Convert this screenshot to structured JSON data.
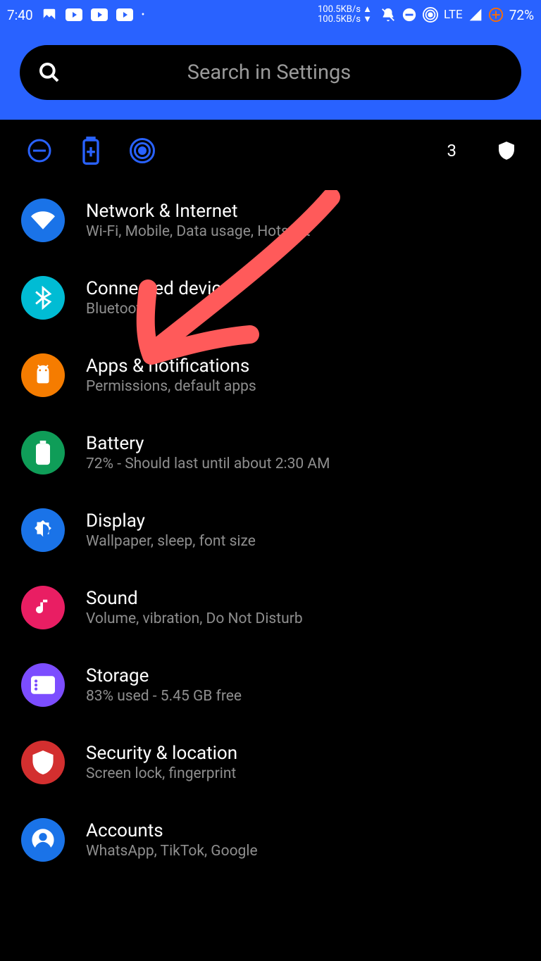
{
  "status": {
    "time": "7:40",
    "net_up": "100.5KB/s ▲",
    "net_dn": "100.5KB/s ▼",
    "lte": "LTE",
    "battery": "72%"
  },
  "search": {
    "placeholder": "Search in Settings"
  },
  "quick": {
    "count": "3"
  },
  "items": [
    {
      "title": "Network & Internet",
      "sub": "Wi-Fi, Mobile, Data usage, Hotspot"
    },
    {
      "title": "Connected devices",
      "sub": "Bluetooth"
    },
    {
      "title": "Apps & notifications",
      "sub": "Permissions, default apps"
    },
    {
      "title": "Battery",
      "sub": "72% - Should last until about 2:30 AM"
    },
    {
      "title": "Display",
      "sub": "Wallpaper, sleep, font size"
    },
    {
      "title": "Sound",
      "sub": "Volume, vibration, Do Not Disturb"
    },
    {
      "title": "Storage",
      "sub": "83% used - 5.45 GB free"
    },
    {
      "title": "Security & location",
      "sub": "Screen lock, fingerprint"
    },
    {
      "title": "Accounts",
      "sub": "WhatsApp, TikTok, Google"
    }
  ]
}
